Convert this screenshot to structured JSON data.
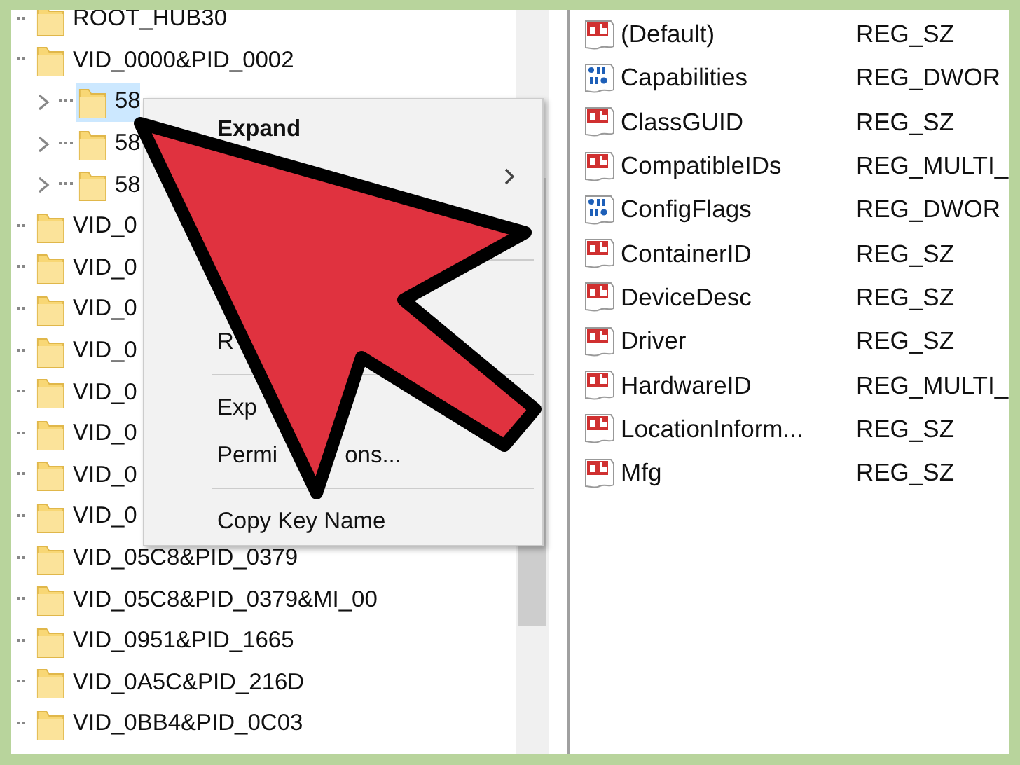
{
  "tree": {
    "items": [
      {
        "text": "ROOT_HUB30",
        "selected": false
      },
      {
        "text": "VID_0000&PID_0002",
        "selected": false,
        "children": [
          {
            "text": "58",
            "selected": true,
            "expanded": false
          },
          {
            "text": "58",
            "selected": false,
            "expanded": false
          },
          {
            "text": "58",
            "selected": false,
            "expanded": false
          }
        ]
      },
      {
        "text": "VID_0",
        "selected": false
      },
      {
        "text": "VID_0",
        "selected": false
      },
      {
        "text": "VID_0",
        "selected": false
      },
      {
        "text": "VID_0",
        "selected": false
      },
      {
        "text": "VID_0",
        "selected": false
      },
      {
        "text": "VID_0",
        "selected": false
      },
      {
        "text": "VID_0",
        "selected": false
      },
      {
        "text": "VID_0",
        "selected": false
      },
      {
        "text": "VID_05C8&PID_0379",
        "selected": false
      },
      {
        "text": "VID_05C8&PID_0379&MI_00",
        "selected": false
      },
      {
        "text": "VID_0951&PID_1665",
        "selected": false
      },
      {
        "text": "VID_0A5C&PID_216D",
        "selected": false
      },
      {
        "text": "VID_0BB4&PID_0C03",
        "selected": false
      }
    ]
  },
  "values": [
    {
      "kind": "string",
      "name": "(Default)",
      "type": "REG_SZ"
    },
    {
      "kind": "binary",
      "name": "Capabilities",
      "type": "REG_DWOR"
    },
    {
      "kind": "string",
      "name": "ClassGUID",
      "type": "REG_SZ"
    },
    {
      "kind": "string",
      "name": "CompatibleIDs",
      "type": "REG_MULTI_"
    },
    {
      "kind": "binary",
      "name": "ConfigFlags",
      "type": "REG_DWOR"
    },
    {
      "kind": "string",
      "name": "ContainerID",
      "type": "REG_SZ"
    },
    {
      "kind": "string",
      "name": "DeviceDesc",
      "type": "REG_SZ"
    },
    {
      "kind": "string",
      "name": "Driver",
      "type": "REG_SZ"
    },
    {
      "kind": "string",
      "name": "HardwareID",
      "type": "REG_MULTI_"
    },
    {
      "kind": "string",
      "name": "LocationInform...",
      "type": "REG_SZ"
    },
    {
      "kind": "string",
      "name": "Mfg",
      "type": "REG_SZ"
    }
  ],
  "context_menu": [
    {
      "kind": "item",
      "text": "Expand",
      "default": true
    },
    {
      "kind": "submenu",
      "default": false
    },
    {
      "kind": "separator"
    },
    {
      "kind": "item",
      "text": "R",
      "default": false
    },
    {
      "kind": "separator"
    },
    {
      "kind": "item",
      "text": "Exp",
      "default": false
    },
    {
      "kind": "split",
      "parts": [
        "Permi",
        "ons..."
      ],
      "default": false
    },
    {
      "kind": "separator"
    },
    {
      "kind": "item",
      "text": "Copy Key Name",
      "default": false
    }
  ]
}
